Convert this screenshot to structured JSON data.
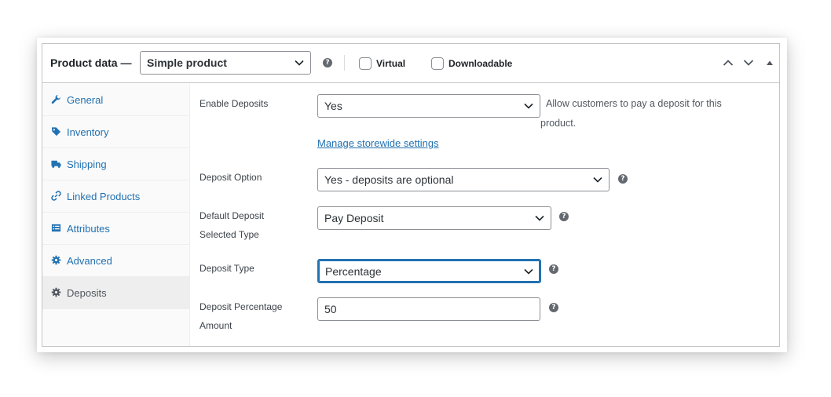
{
  "header": {
    "title": "Product data —",
    "product_type": "Simple product",
    "virtual_label": "Virtual",
    "downloadable_label": "Downloadable",
    "virtual_checked": false,
    "downloadable_checked": false
  },
  "sidebar": {
    "items": [
      {
        "label": "General",
        "icon": "wrench-icon"
      },
      {
        "label": "Inventory",
        "icon": "tag-icon"
      },
      {
        "label": "Shipping",
        "icon": "truck-icon"
      },
      {
        "label": "Linked Products",
        "icon": "link-icon"
      },
      {
        "label": "Attributes",
        "icon": "list-icon"
      },
      {
        "label": "Advanced",
        "icon": "gear-icon"
      },
      {
        "label": "Deposits",
        "icon": "gear-icon",
        "active": true
      }
    ]
  },
  "deposits": {
    "enable_label": "Enable Deposits",
    "enable_value": "Yes",
    "enable_desc": "Allow customers to pay a deposit for this",
    "enable_desc_2": "product.",
    "manage_link": "Manage storewide settings",
    "option_label": "Deposit Option",
    "option_value": "Yes - deposits are optional",
    "default_type_label_1": "Default Deposit",
    "default_type_label_2": "Selected Type",
    "default_type_value": "Pay Deposit",
    "type_label": "Deposit Type",
    "type_value": "Percentage",
    "amount_label_1": "Deposit Percentage",
    "amount_label_2": "Amount",
    "amount_value": "50"
  },
  "colors": {
    "accent": "#2271b1",
    "border": "#c3c4c7",
    "help_icon": "#646970"
  }
}
